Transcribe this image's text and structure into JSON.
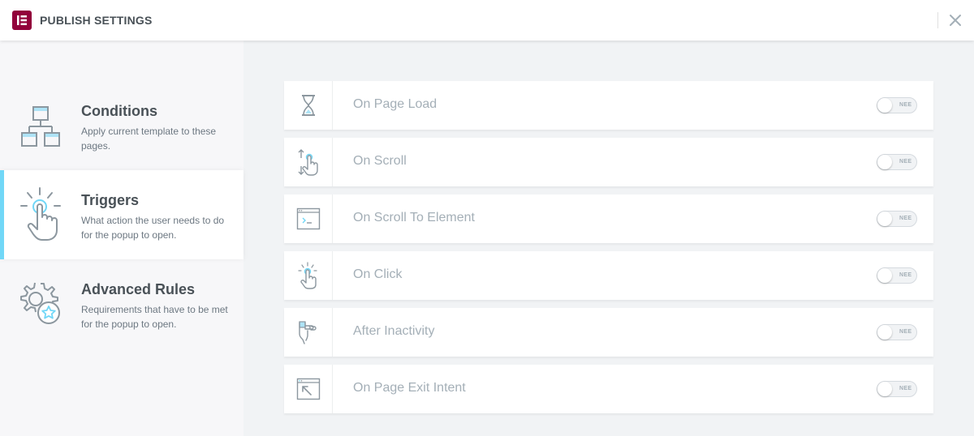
{
  "header": {
    "title": "PUBLISH SETTINGS",
    "brand_color": "#92003b"
  },
  "sidebar": {
    "accent_color": "#71d7f7",
    "tabs": [
      {
        "title": "Conditions",
        "description": "Apply current template to these pages.",
        "icon": "sitemap-icon",
        "active": false
      },
      {
        "title": "Triggers",
        "description": "What action the user needs to do for the popup to open.",
        "icon": "tap-hand-icon",
        "active": true
      },
      {
        "title": "Advanced Rules",
        "description": "Requirements that have to be met for the popup to open.",
        "icon": "gear-star-icon",
        "active": false
      }
    ]
  },
  "triggers": [
    {
      "label": "On Page Load",
      "icon": "hourglass-icon",
      "toggle_text": "NEE",
      "enabled": false
    },
    {
      "label": "On Scroll",
      "icon": "scroll-hand-icon",
      "toggle_text": "NEE",
      "enabled": false
    },
    {
      "label": "On Scroll To Element",
      "icon": "terminal-window-icon",
      "toggle_text": "NEE",
      "enabled": false
    },
    {
      "label": "On Click",
      "icon": "click-hand-icon",
      "toggle_text": "NEE",
      "enabled": false
    },
    {
      "label": "After Inactivity",
      "icon": "inactive-hand-icon",
      "toggle_text": "NEE",
      "enabled": false
    },
    {
      "label": "On Page Exit Intent",
      "icon": "exit-window-icon",
      "toggle_text": "NEE",
      "enabled": false
    }
  ]
}
